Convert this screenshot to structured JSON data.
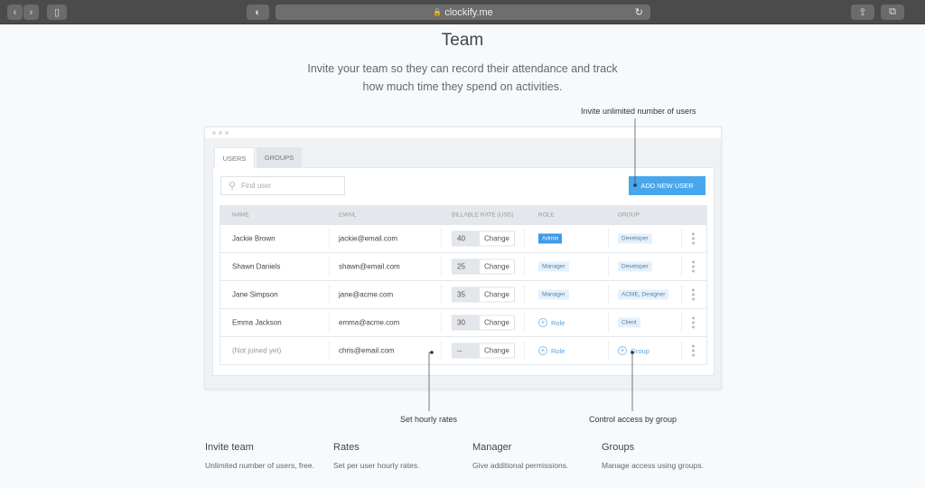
{
  "browser": {
    "url": "clockify.me"
  },
  "page": {
    "title": "Team",
    "subtitle_line1": "Invite your team so they can record their attendance and track",
    "subtitle_line2": "how much time they spend on activities."
  },
  "annotations": {
    "invite": "Invite unlimited number of users",
    "rates": "Set hourly rates",
    "group": "Control access by group"
  },
  "app": {
    "tabs": [
      {
        "label": "USERS",
        "active": true
      },
      {
        "label": "GROUPS",
        "active": false
      }
    ],
    "search_placeholder": "Find user",
    "add_button": "ADD NEW USER",
    "columns": [
      "NAME",
      "EMAIL",
      "BILLABLE RATE (USD)",
      "ROLE",
      "GROUP"
    ],
    "change_label": "Change",
    "rows": [
      {
        "name": "Jackie Brown",
        "email": "jackie@email.com",
        "rate": "40",
        "role": "Admin",
        "group": "Developer"
      },
      {
        "name": "Shawn Daniels",
        "email": "shawn@email.com",
        "rate": "25",
        "role": "Manager",
        "group": "Developer"
      },
      {
        "name": "Jane Simpson",
        "email": "jane@acme.com",
        "rate": "35",
        "role": "Manager",
        "group": "ACME, Designer"
      },
      {
        "name": "Emma Jackson",
        "email": "emma@acme.com",
        "rate": "30",
        "role": "Role",
        "group": "Client"
      },
      {
        "name": "(Not joined yet)",
        "email": "chris@email.com",
        "rate": "--",
        "role": "Role",
        "group": "Group"
      }
    ],
    "colors": {
      "accent": "#48a7ec",
      "admin_badge": "#3d9be9",
      "badge_bg": "#e4f1fc"
    }
  },
  "features": [
    {
      "title": "Invite team",
      "desc": "Unlimited number of users, free."
    },
    {
      "title": "Rates",
      "desc": "Set per user hourly rates."
    },
    {
      "title": "Manager",
      "desc": "Give additional permissions."
    },
    {
      "title": "Groups",
      "desc": "Manage access using groups."
    }
  ]
}
